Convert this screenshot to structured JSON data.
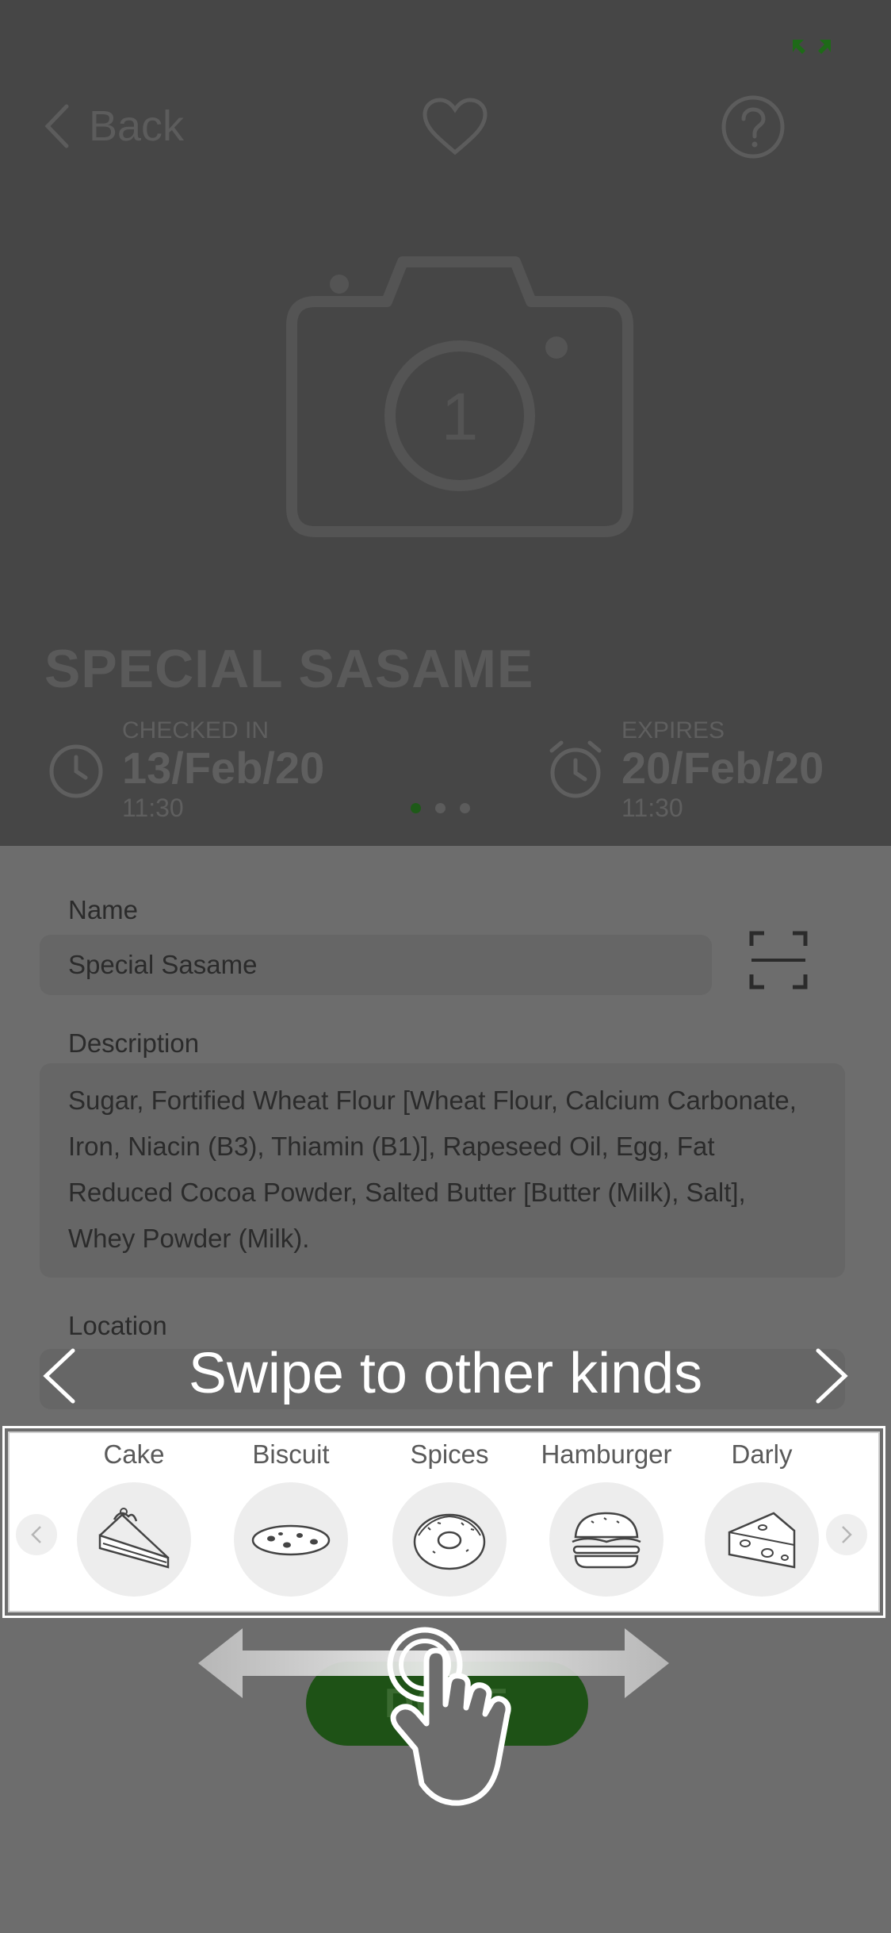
{
  "header": {
    "back_label": "Back",
    "icons": [
      "expand-icon",
      "chevron-left-icon",
      "heart-icon",
      "help-icon",
      "camera-icon"
    ]
  },
  "hero": {
    "photo_count": "1",
    "title": "SPECIAL SASAME",
    "checked_in": {
      "caption": "CHECKED IN",
      "date": "13/Feb/20",
      "time": "11:30"
    },
    "expires": {
      "caption": "EXPIRES",
      "date": "20/Feb/20",
      "time": "11:30"
    },
    "pager": {
      "count": 3,
      "active_index": 0
    }
  },
  "form": {
    "name_label": "Name",
    "name_value": "Special Sasame",
    "description_label": "Description",
    "description_value": "Sugar, Fortified Wheat Flour [Wheat Flour, Calcium Carbonate, Iron, Niacin (B3), Thiamin (B1)], Rapeseed Oil, Egg, Fat Reduced Cocoa Powder, Salted Butter [Butter (Milk), Salt], Whey Powder (Milk).",
    "location_label": "Location",
    "done_label": "DONE"
  },
  "tutorial": {
    "title": "Swipe to other kinds",
    "kinds": [
      {
        "label": "Cake",
        "icon": "cake-icon"
      },
      {
        "label": "Biscuit",
        "icon": "biscuit-icon"
      },
      {
        "label": "Spices",
        "icon": "donut-icon"
      },
      {
        "label": "Hamburger",
        "icon": "hamburger-icon"
      },
      {
        "label": "Darly",
        "icon": "cheese-icon"
      }
    ]
  },
  "colors": {
    "overlay": "#6d6d6d",
    "hero": "#464646",
    "accent_green": "#1e5216",
    "panel": "#ffffff"
  }
}
